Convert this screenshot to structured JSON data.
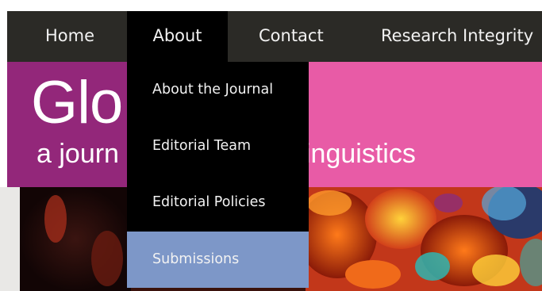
{
  "nav": {
    "items": [
      {
        "label": "Home"
      },
      {
        "label": "About"
      },
      {
        "label": "Contact"
      },
      {
        "label": "Research Integrity"
      }
    ],
    "active": "About"
  },
  "banner": {
    "title": "Glo",
    "subtitle_left": "a journ",
    "subtitle_right": "inguistics"
  },
  "dropdown": {
    "items": [
      {
        "label": "About the Journal"
      },
      {
        "label": "Editorial Team"
      },
      {
        "label": "Editorial Policies"
      },
      {
        "label": "Submissions",
        "highlighted": true
      }
    ]
  },
  "colors": {
    "nav_bg": "#2b2a26",
    "dropdown_bg": "#000000",
    "banner_pink": "#e85ba6",
    "banner_purple": "#93277a",
    "highlight": "#7d97c8"
  }
}
